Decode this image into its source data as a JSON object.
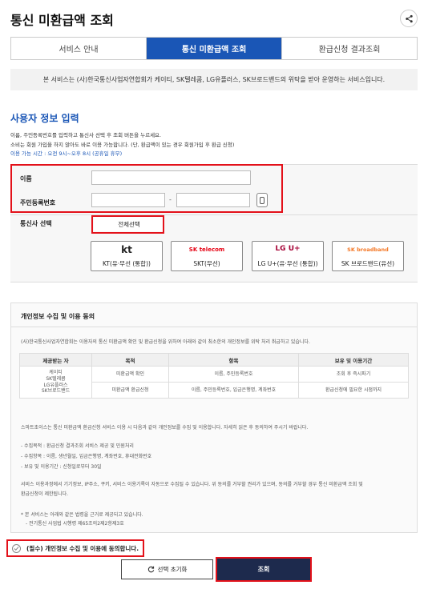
{
  "header": {
    "title": "통신 미환급액 조회",
    "share_icon": "share-icon"
  },
  "tabs": [
    {
      "label": "서비스 안내",
      "active": false
    },
    {
      "label": "통신 미환급액 조회",
      "active": true
    },
    {
      "label": "환급신청 결과조회",
      "active": false
    }
  ],
  "notice": "본 서비스는 (사)한국통신사업자연합회가 케이티, SK텔레콤, LG유플러스, SK브로드밴드의 위탁을 받아 운영하는 서비스입니다.",
  "user_info": {
    "title": "사용자 정보 입력",
    "desc_lines": [
      "이름, 주민등록번호를 입력하고 통신사 선택 후 조회 버튼을 누르세요.",
      "소비는 회원 가입을 하지 않아도 바로 이용 가능합니다. (단, 환급액이 있는 경우 회원가입 후 환급 신청)",
      "이용 가능 시간 : 오전 9시~오후 8시 (공휴일 휴무)"
    ],
    "name_label": "이름",
    "name_value": "",
    "rrn_label": "주민등록번호",
    "rrn_front": "",
    "rrn_back": "",
    "rrn_separator": "-",
    "carrier_label": "통신사 선택",
    "select_all_label": "전체선택",
    "carriers": [
      {
        "logo": "kt",
        "name": "KT(유·무선 (통합))",
        "color": "#222222"
      },
      {
        "logo": "SK telecom",
        "name": "SKT(무선)",
        "color": "#e60012"
      },
      {
        "logo": "LG U+",
        "name": "LG U+(유·무선 (통합))",
        "color": "#a50034"
      },
      {
        "logo": "SK broadband",
        "name": "SK 브로드밴드(유선)",
        "color": "#f47725"
      }
    ]
  },
  "consent": {
    "title": "개인정보 수집 및 이용 동의",
    "intro": "(사)한국통신사업자연합회는 이용자의 통신 미환급액 확인 및 환급신청을 위하여 아래와 같이 최소한의 개인정보를 위탁 처리 취급하고 있습니다.",
    "table": {
      "headers": [
        "제공받는 자",
        "목적",
        "항목",
        "보유 및 이용기간"
      ],
      "provider": "케이티\nSK텔레콤\nLG유플러스\nSK브로드밴드",
      "rows": [
        {
          "purpose": "미환급액 확인",
          "items": "이름, 주민등록번호",
          "period": "조회 후 즉시파기"
        },
        {
          "purpose": "미환급액 환급신청",
          "items": "이름, 주민등록번호, 입금은행명, 계좌번호",
          "period": "환급신청에 필요한 시점까지"
        }
      ]
    },
    "para1": "스마트초이스는 통신 미환급액 환급신청 서비스 이용 시 다음과 같이 개인정보를 수집 및 이용합니다. 자세히 읽은 후 동의하여 주시기 바랍니다.",
    "list": [
      "- 수집목적 : 환급신청 결과조회 서비스 제공 및 민원처리",
      "- 수집항목 : 이름, 생년월일, 입금은행명, 계좌번호, 휴대전화번호",
      "- 보유 및 이용기간 : 신청일로부터 30일"
    ],
    "para2": "서비스 이용과정에서 기기정보, IP주소, 쿠키, 서비스 이용기록이 자동으로 수집될 수 있습니다. 위 동의를 거부할 권리가 있으며, 동의를 거부할 경우 통신 미환급액 조회 및",
    "para2b": "환급신청이 제한됩니다.",
    "law1": "* 본 서비스는 아래와 같은 법령을 근거로 제공되고 있습니다.",
    "law2": "- 전기통신 사업법 시행령 제65조의2제2항제3호"
  },
  "agree_label": "(필수) 개인정보 수집 및 이용에 동의합니다.",
  "buttons": {
    "reset": "선택 초기화",
    "submit": "조회"
  }
}
